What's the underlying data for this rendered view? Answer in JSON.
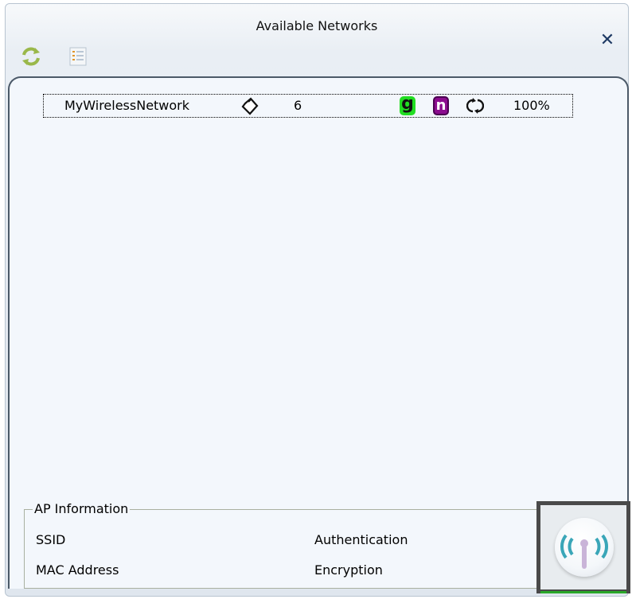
{
  "window": {
    "title": "Available Networks",
    "close_glyph": "✕"
  },
  "toolbar": {
    "refresh_icon": "refresh-icon",
    "list_icon": "list-view-icon"
  },
  "networks": [
    {
      "ssid": "MyWirelessNetwork",
      "security_icon": "lock-icon",
      "channel": "6",
      "mode_g": "g",
      "mode_n": "n",
      "wps_icon": "wps-icon",
      "signal": "100%"
    }
  ],
  "ap_info": {
    "legend": "AP Information",
    "ssid_label": "SSID",
    "mac_label": "MAC Address",
    "auth_label": "Authentication",
    "enc_label": "Encryption"
  },
  "status": {
    "icon": "wireless-antenna-icon"
  },
  "colors": {
    "mode_g_bg": "#22dd22",
    "mode_n_bg": "#8b0c8e",
    "panel_bg": "#f3f7fc",
    "status_frame": "#4a4a4a"
  }
}
